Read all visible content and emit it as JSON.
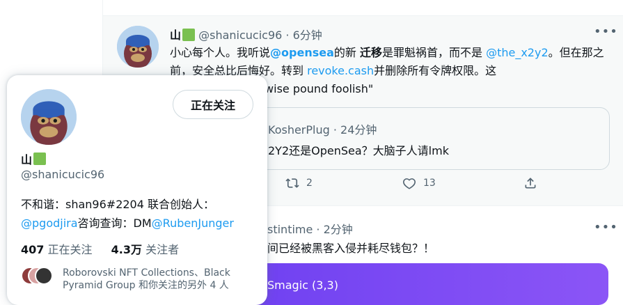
{
  "tweet": {
    "name": "山",
    "handle": "@shanicucic96",
    "sep": "·",
    "time": "6分钟",
    "text": {
      "p1": "小心每个人。我听说",
      "mention1": "@opensea",
      "p2": "的新 ",
      "bold": "迁移",
      "p3": "是罪魁祸首，而不是 ",
      "mention2": "@the_x2y2",
      "p4": "。但在那之前，安全总比后悔好。转到 ",
      "link": "revoke.cash",
      "p5": "并删除所有令牌权限。这",
      "p6": "由，但不要\"Pennywise pound foolish\""
    },
    "quote": {
      "header": "KosherPlug · 24分钟",
      "text": "2Y2还是OpenSea？大脑子人请lmk"
    },
    "actions": {
      "retweets": "2",
      "likes": "13"
    }
  },
  "tweet2": {
    "header": "stintime · 2分钟",
    "text": "间已经被黑客入侵并耗尽钱包？！",
    "card_title": "Smagic (3,3)"
  },
  "hovercard": {
    "follow_label": "正在关注",
    "name": "山",
    "handle": "@shanicucic96",
    "bio": {
      "line1": "不和谐：shan96#2204 联合创始人：",
      "mention1": "@pgodjira",
      "mid": "咨询查询：DM",
      "mention2": "@RubenJunger"
    },
    "following_count": "407",
    "following_label": "正在关注",
    "followers_count": "4.3万",
    "followers_label": "关注者",
    "mutual_text": "Roborovski NFT Collections、Black Pyramid Group 和你关注的另外 4 人"
  },
  "colors": {
    "accent": "#1d9bf0",
    "text": "#0f1419",
    "secondary": "#536471",
    "verified_square": "#7ac050"
  }
}
